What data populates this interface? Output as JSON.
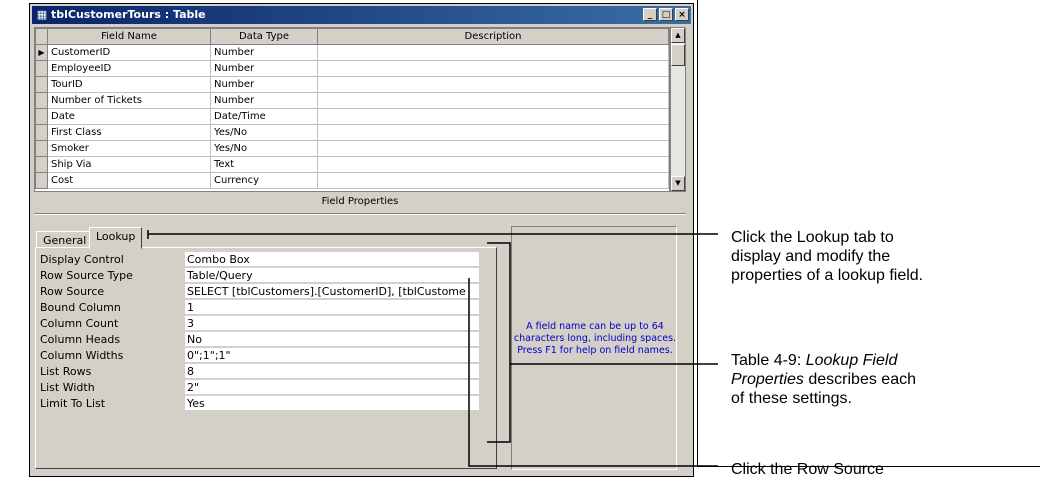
{
  "window": {
    "title": "tblCustomerTours : Table",
    "controls": [
      "_",
      "□",
      "×"
    ]
  },
  "grid": {
    "columns": [
      "Field Name",
      "Data Type",
      "Description"
    ],
    "rows": [
      {
        "name": "CustomerID",
        "type": "Number",
        "desc": "",
        "current": true
      },
      {
        "name": "EmployeeID",
        "type": "Number",
        "desc": ""
      },
      {
        "name": "TourID",
        "type": "Number",
        "desc": ""
      },
      {
        "name": "Number of Tickets",
        "type": "Number",
        "desc": ""
      },
      {
        "name": "Date",
        "type": "Date/Time",
        "desc": ""
      },
      {
        "name": "First Class",
        "type": "Yes/No",
        "desc": ""
      },
      {
        "name": "Smoker",
        "type": "Yes/No",
        "desc": ""
      },
      {
        "name": "Ship Via",
        "type": "Text",
        "desc": ""
      },
      {
        "name": "Cost",
        "type": "Currency",
        "desc": ""
      }
    ]
  },
  "field_properties_label": "Field Properties",
  "tabs": {
    "general": "General",
    "lookup": "Lookup"
  },
  "properties": [
    {
      "name": "Display Control",
      "value": "Combo Box"
    },
    {
      "name": "Row Source Type",
      "value": "Table/Query"
    },
    {
      "name": "Row Source",
      "value": "SELECT [tblCustomers].[CustomerID], [tblCustome"
    },
    {
      "name": "Bound Column",
      "value": "1"
    },
    {
      "name": "Column Count",
      "value": "3"
    },
    {
      "name": "Column Heads",
      "value": "No"
    },
    {
      "name": "Column Widths",
      "value": "0\";1\";1\""
    },
    {
      "name": "List Rows",
      "value": "8"
    },
    {
      "name": "List Width",
      "value": "2\""
    },
    {
      "name": "Limit To List",
      "value": "Yes"
    }
  ],
  "help_text": "A field name can be up to 64 characters long, including spaces. Press F1 for help on field names.",
  "callouts": {
    "lookup_tab": [
      "Click the Lookup tab to",
      "display and modify the",
      "properties of a lookup field."
    ],
    "table_ref": {
      "prefix": "Table 4-9: ",
      "italic1": "Lookup Field",
      "italic2": "Properties",
      "rest1": " describes each",
      "rest2": "of these settings."
    },
    "row_source": "Click the Row Source"
  }
}
